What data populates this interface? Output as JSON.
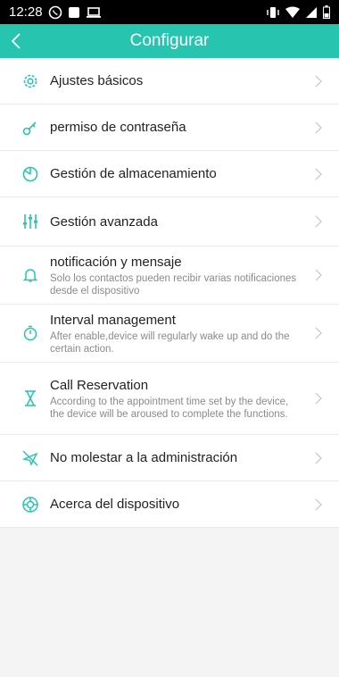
{
  "status": {
    "time": "12:28"
  },
  "header": {
    "title": "Configurar"
  },
  "colors": {
    "accent": "#27c4b0",
    "icon": "#27c4b0"
  },
  "items": [
    {
      "icon": "gear-icon",
      "label": "Ajustes básicos"
    },
    {
      "icon": "key-icon",
      "label": "permiso de contraseña"
    },
    {
      "icon": "clock-icon",
      "label": "Gestión de almacenamiento"
    },
    {
      "icon": "sliders-icon",
      "label": "Gestión avanzada"
    },
    {
      "icon": "bell-icon",
      "label": "notificación y mensaje",
      "sub": "Solo los contactos pueden recibir varias notificaciones desde el dispositivo"
    },
    {
      "icon": "timer-icon",
      "label": "Interval management",
      "sub": "After enable,device will regularly wake up and do the certain action."
    },
    {
      "icon": "hourglass-icon",
      "label": "Call Reservation",
      "sub": "According to the appointment time set by the device, the device will be aroused to complete the functions."
    },
    {
      "icon": "airplane-off-icon",
      "label": "No molestar a la administración"
    },
    {
      "icon": "info-badge-icon",
      "label": "Acerca del dispositivo"
    }
  ]
}
